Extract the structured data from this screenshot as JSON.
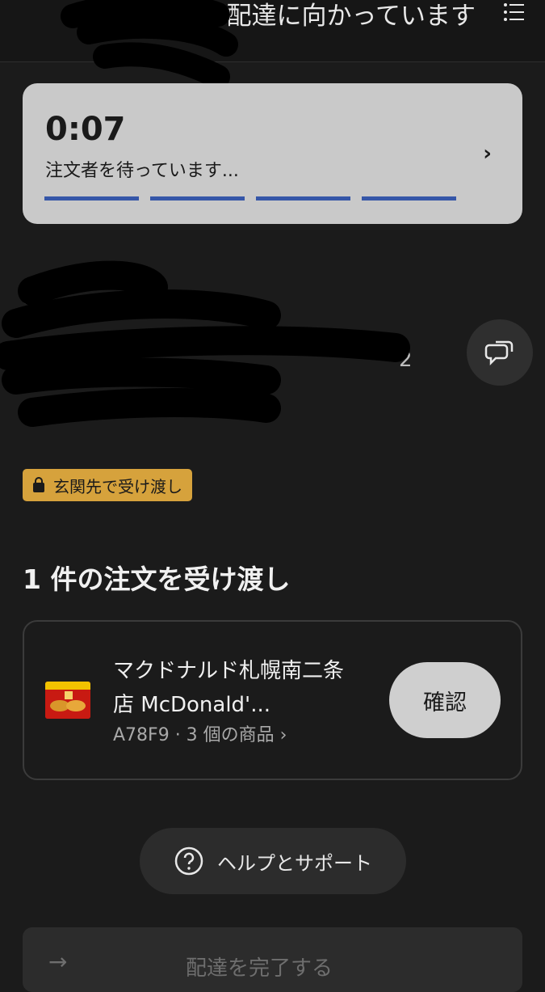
{
  "header": {
    "title": "へ配達に向かっています",
    "menu_icon": "list-menu-icon"
  },
  "timer_card": {
    "time": "0:07",
    "status": "注文者を待っています...",
    "chevron": "›",
    "progress_segments": 4
  },
  "customer": {
    "name_fragment": "渡",
    "detail_fragment": "2",
    "chat_icon": "chat-bubbles-icon"
  },
  "handoff_badge": {
    "label": "玄関先で受け渡し",
    "icon": "shopping-bag-icon",
    "color": "#d6a23c"
  },
  "orders_section": {
    "title": "1 件の注文を受け渡し"
  },
  "order": {
    "store_name": "マクドナルド札幌南二条店 McDonald'...",
    "meta": "A78F9 · 3 個の商品 ›",
    "confirm_label": "確認"
  },
  "help": {
    "label": "ヘルプとサポート",
    "icon": "question-circle-icon"
  },
  "complete": {
    "label": "配達を完了する",
    "icon": "arrow-right-icon"
  },
  "colors": {
    "background": "#1b1b1b",
    "accent_progress": "#3556a8",
    "badge": "#d6a23c"
  }
}
